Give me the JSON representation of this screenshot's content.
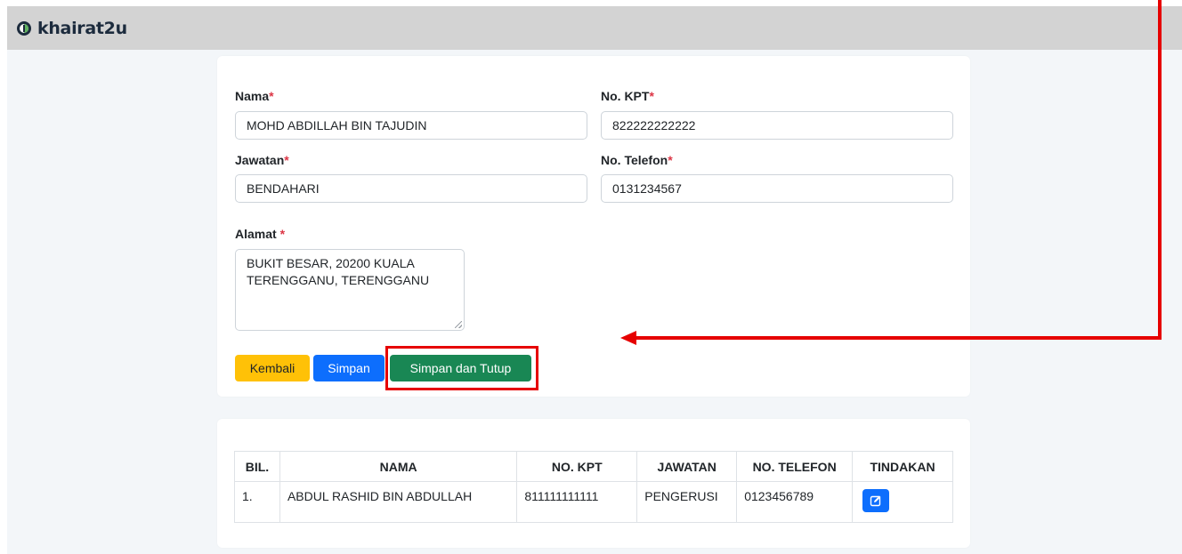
{
  "app": {
    "brand": "khairat2u"
  },
  "form": {
    "nama": {
      "label": "Nama",
      "required": "*",
      "value": "MOHD ABDILLAH BIN TAJUDIN"
    },
    "kpt": {
      "label": "No. KPT",
      "required": "*",
      "value": "822222222222"
    },
    "jawatan": {
      "label": "Jawatan",
      "required": "*",
      "value": "BENDAHARI"
    },
    "telefon": {
      "label": "No. Telefon",
      "required": "*",
      "value": "0131234567"
    },
    "alamat": {
      "label": "Alamat ",
      "required": "*",
      "value": "BUKIT BESAR, 20200 KUALA TERENGGANU, TERENGGANU"
    }
  },
  "buttons": {
    "kembali": "Kembali",
    "simpan": "Simpan",
    "simpan_tutup": "Simpan dan Tutup"
  },
  "table": {
    "headers": [
      "BIL.",
      "NAMA",
      "NO. KPT",
      "JAWATAN",
      "NO. TELEFON",
      "TINDAKAN"
    ],
    "rows": [
      {
        "bil": "1.",
        "nama": "ABDUL RASHID BIN ABDULLAH",
        "kpt": "811111111111",
        "jawatan": "PENGERUSI",
        "telefon": "0123456789"
      }
    ]
  },
  "colors": {
    "primary": "#0d6efd",
    "success": "#198754",
    "warning": "#ffc107",
    "danger": "#dc3545",
    "annotation": "#e60000"
  },
  "icons": {
    "logo": "khairat2u-logo-icon",
    "edit": "edit-icon"
  }
}
